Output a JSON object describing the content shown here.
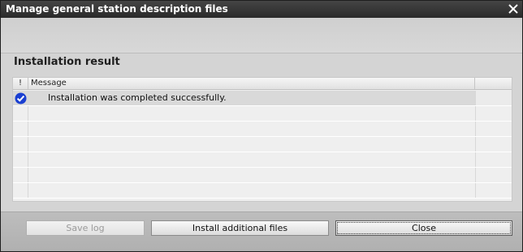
{
  "window": {
    "title": "Manage general station description files"
  },
  "section": {
    "title": "Installation result"
  },
  "table": {
    "headers": [
      "!",
      "Message"
    ],
    "rows": [
      {
        "status_icon": "success-check-icon",
        "message": "Installation was completed successfully."
      },
      {
        "status_icon": "",
        "message": ""
      },
      {
        "status_icon": "",
        "message": ""
      },
      {
        "status_icon": "",
        "message": ""
      },
      {
        "status_icon": "",
        "message": ""
      },
      {
        "status_icon": "",
        "message": ""
      },
      {
        "status_icon": "",
        "message": ""
      }
    ]
  },
  "buttons": {
    "save_log": "Save log",
    "install_additional": "Install additional files",
    "close": "Close"
  },
  "colors": {
    "title_bar": "#2f2f2f",
    "success": "#1a3fd1"
  }
}
